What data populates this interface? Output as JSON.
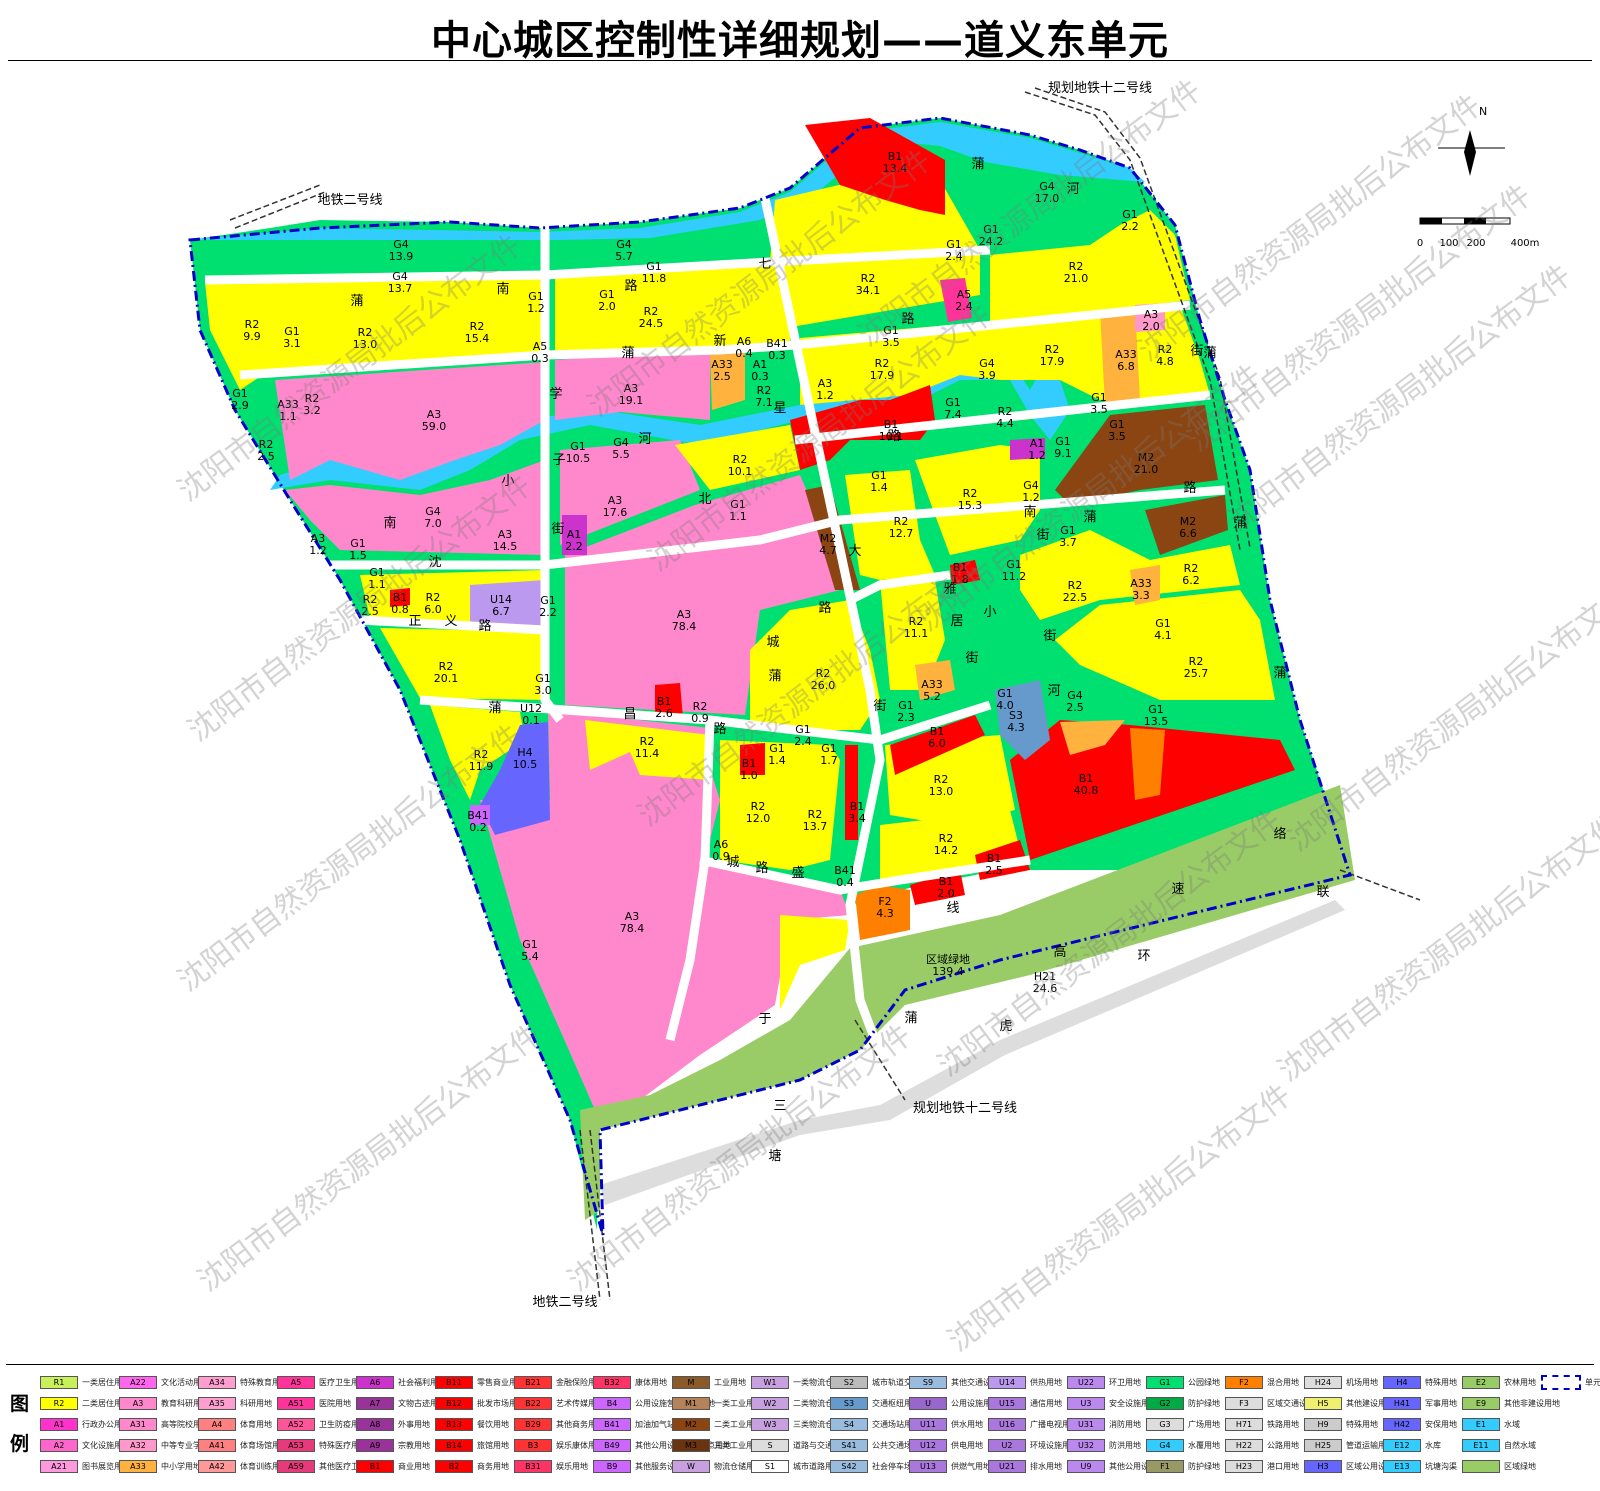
{
  "title": "中心城区控制性详细规划——道义东单元",
  "map": {
    "subway_labels": [
      {
        "id": "subway-12-top",
        "text": "规划地铁十二号线"
      },
      {
        "id": "subway-2-top",
        "text": "地铁二号线"
      },
      {
        "id": "subway-12-bottom",
        "text": "规划地铁十二号线"
      },
      {
        "id": "subway-2-bottom",
        "text": "地铁二号线"
      }
    ],
    "north_label": "N",
    "scale_ticks": [
      "0",
      "100",
      "200",
      "400m"
    ],
    "road_chars": [
      {
        "id": "r1",
        "text": "蒲"
      },
      {
        "id": "r2",
        "text": "河"
      },
      {
        "id": "r3",
        "text": "七"
      },
      {
        "id": "r4",
        "text": "南"
      },
      {
        "id": "r5",
        "text": "路"
      },
      {
        "id": "r6",
        "text": "蒲"
      },
      {
        "id": "r7",
        "text": "新"
      },
      {
        "id": "r8",
        "text": "蒲"
      },
      {
        "id": "r9",
        "text": "路"
      },
      {
        "id": "r10",
        "text": "星"
      },
      {
        "id": "r11",
        "text": "路"
      },
      {
        "id": "r12",
        "text": "学"
      },
      {
        "id": "r13",
        "text": "子"
      },
      {
        "id": "r14",
        "text": "河"
      },
      {
        "id": "r15",
        "text": "小"
      },
      {
        "id": "r16",
        "text": "南"
      },
      {
        "id": "r17",
        "text": "北"
      },
      {
        "id": "r18",
        "text": "街"
      },
      {
        "id": "r19",
        "text": "大"
      },
      {
        "id": "r20",
        "text": "沈"
      },
      {
        "id": "r21",
        "text": "正"
      },
      {
        "id": "r22",
        "text": "义"
      },
      {
        "id": "r23",
        "text": "路"
      },
      {
        "id": "r24",
        "text": "路"
      },
      {
        "id": "r25",
        "text": "城"
      },
      {
        "id": "r26",
        "text": "蒲"
      },
      {
        "id": "r27",
        "text": "昌"
      },
      {
        "id": "r28",
        "text": "路"
      },
      {
        "id": "r29",
        "text": "蒲"
      },
      {
        "id": "r30",
        "text": "街"
      },
      {
        "id": "r31",
        "text": "南"
      },
      {
        "id": "r32",
        "text": "蒲"
      },
      {
        "id": "r33",
        "text": "路"
      },
      {
        "id": "r34",
        "text": "蒲"
      },
      {
        "id": "r35",
        "text": "雅"
      },
      {
        "id": "r36",
        "text": "居"
      },
      {
        "id": "r37",
        "text": "街"
      },
      {
        "id": "r38",
        "text": "小"
      },
      {
        "id": "r39",
        "text": "街"
      },
      {
        "id": "r40",
        "text": "河"
      },
      {
        "id": "r41",
        "text": "蒲"
      },
      {
        "id": "r42",
        "text": "城"
      },
      {
        "id": "r43",
        "text": "路"
      },
      {
        "id": "r44",
        "text": "盛"
      },
      {
        "id": "r45",
        "text": "线"
      },
      {
        "id": "r46",
        "text": "络"
      },
      {
        "id": "r47",
        "text": "速"
      },
      {
        "id": "r48",
        "text": "联"
      },
      {
        "id": "r49",
        "text": "高"
      },
      {
        "id": "r50",
        "text": "环"
      },
      {
        "id": "r51",
        "text": "虎"
      },
      {
        "id": "r52",
        "text": "蒲"
      },
      {
        "id": "r53",
        "text": "于"
      },
      {
        "id": "r54",
        "text": "三"
      },
      {
        "id": "r55",
        "text": "塘"
      },
      {
        "id": "r56",
        "text": "街"
      },
      {
        "id": "r57",
        "text": "蒲"
      },
      {
        "id": "r58",
        "text": "街"
      }
    ],
    "parcels": [
      {
        "code": "B1",
        "area": "13.4"
      },
      {
        "code": "G4",
        "area": "17.0"
      },
      {
        "code": "G1",
        "area": "24.2"
      },
      {
        "code": "G1",
        "area": "2.2"
      },
      {
        "code": "G1",
        "area": "2.4"
      },
      {
        "code": "R2",
        "area": "21.0"
      },
      {
        "code": "R2",
        "area": "34.1"
      },
      {
        "code": "A5",
        "area": "2.4"
      },
      {
        "code": "G4",
        "area": "13.9"
      },
      {
        "code": "G4",
        "area": "5.7"
      },
      {
        "code": "G1",
        "area": "11.8"
      },
      {
        "code": "G4",
        "area": "13.7"
      },
      {
        "code": "G1",
        "area": "1.2"
      },
      {
        "code": "G1",
        "area": "2.0"
      },
      {
        "code": "R2",
        "area": "24.5"
      },
      {
        "code": "R2",
        "area": "9.9"
      },
      {
        "code": "G1",
        "area": "3.1"
      },
      {
        "code": "R2",
        "area": "13.0"
      },
      {
        "code": "R2",
        "area": "15.4"
      },
      {
        "code": "A5",
        "area": "0.3"
      },
      {
        "code": "A6",
        "area": "0.4"
      },
      {
        "code": "B41",
        "area": "0.3"
      },
      {
        "code": "A1",
        "area": "0.3"
      },
      {
        "code": "A33",
        "area": "2.5"
      },
      {
        "code": "R2",
        "area": "7.1"
      },
      {
        "code": "G1",
        "area": "3.5"
      },
      {
        "code": "R2",
        "area": "17.9"
      },
      {
        "code": "A3",
        "area": "2.0"
      },
      {
        "code": "A33",
        "area": "6.8"
      },
      {
        "code": "R2",
        "area": "4.8"
      },
      {
        "code": "R2",
        "area": "17.9"
      },
      {
        "code": "G4",
        "area": "3.9"
      },
      {
        "code": "A3",
        "area": "1.2"
      },
      {
        "code": "B1",
        "area": "10.1"
      },
      {
        "code": "G1",
        "area": "7.4"
      },
      {
        "code": "R2",
        "area": "4.4"
      },
      {
        "code": "G1",
        "area": "3.5"
      },
      {
        "code": "G1",
        "area": "3.5"
      },
      {
        "code": "A3",
        "area": "19.1"
      },
      {
        "code": "G1",
        "area": "2.9"
      },
      {
        "code": "A33",
        "area": "1.1"
      },
      {
        "code": "R2",
        "area": "3.2"
      },
      {
        "code": "A3",
        "area": "59.0"
      },
      {
        "code": "R2",
        "area": "2.5"
      },
      {
        "code": "G1",
        "area": "10.5"
      },
      {
        "code": "G4",
        "area": "5.5"
      },
      {
        "code": "R2",
        "area": "10.1"
      },
      {
        "code": "A1",
        "area": "1.2"
      },
      {
        "code": "G1",
        "area": "9.1"
      },
      {
        "code": "M2",
        "area": "21.0"
      },
      {
        "code": "G1",
        "area": "1.4"
      },
      {
        "code": "R2",
        "area": "15.3"
      },
      {
        "code": "A3",
        "area": "17.6"
      },
      {
        "code": "G1",
        "area": "1.1"
      },
      {
        "code": "G4",
        "area": "1.2"
      },
      {
        "code": "M2",
        "area": "6.6"
      },
      {
        "code": "G4",
        "area": "7.0"
      },
      {
        "code": "A3",
        "area": "14.5"
      },
      {
        "code": "A1",
        "area": "2.2"
      },
      {
        "code": "M2",
        "area": "4.7"
      },
      {
        "code": "R2",
        "area": "12.7"
      },
      {
        "code": "G1",
        "area": "3.7"
      },
      {
        "code": "A3",
        "area": "1.2"
      },
      {
        "code": "G1",
        "area": "1.5"
      },
      {
        "code": "G1",
        "area": "11.2"
      },
      {
        "code": "B1",
        "area": "1.8"
      },
      {
        "code": "R2",
        "area": "22.5"
      },
      {
        "code": "A33",
        "area": "3.3"
      },
      {
        "code": "R2",
        "area": "6.2"
      },
      {
        "code": "G1",
        "area": "1.1"
      },
      {
        "code": "R2",
        "area": "2.5"
      },
      {
        "code": "B1",
        "area": "0.8"
      },
      {
        "code": "R2",
        "area": "6.0"
      },
      {
        "code": "U14",
        "area": "6.7"
      },
      {
        "code": "G1",
        "area": "2.2"
      },
      {
        "code": "A3",
        "area": "78.4"
      },
      {
        "code": "R2",
        "area": "11.1"
      },
      {
        "code": "G1",
        "area": "4.1"
      },
      {
        "code": "R2",
        "area": "25.7"
      },
      {
        "code": "R2",
        "area": "20.1"
      },
      {
        "code": "G1",
        "area": "3.0"
      },
      {
        "code": "R2",
        "area": "26.0"
      },
      {
        "code": "A33",
        "area": "5.2"
      },
      {
        "code": "G1",
        "area": "4.0"
      },
      {
        "code": "G4",
        "area": "2.5"
      },
      {
        "code": "S3",
        "area": "4.3"
      },
      {
        "code": "G1",
        "area": "13.5"
      },
      {
        "code": "B1",
        "area": "2.6"
      },
      {
        "code": "R2",
        "area": "0.9"
      },
      {
        "code": "U12",
        "area": "0.1"
      },
      {
        "code": "G1",
        "area": "2.3"
      },
      {
        "code": "G1",
        "area": "2.4"
      },
      {
        "code": "B1",
        "area": "6.0"
      },
      {
        "code": "R2",
        "area": "11.4"
      },
      {
        "code": "R2",
        "area": "11.9"
      },
      {
        "code": "H4",
        "area": "10.5"
      },
      {
        "code": "G1",
        "area": "1.4"
      },
      {
        "code": "G1",
        "area": "1.7"
      },
      {
        "code": "B1",
        "area": "1.0"
      },
      {
        "code": "R2",
        "area": "13.0"
      },
      {
        "code": "B1",
        "area": "40.8"
      },
      {
        "code": "B41",
        "area": "0.2"
      },
      {
        "code": "R2",
        "area": "12.0"
      },
      {
        "code": "R2",
        "area": "13.7"
      },
      {
        "code": "B1",
        "area": "3.4"
      },
      {
        "code": "R2",
        "area": "14.2"
      },
      {
        "code": "A6",
        "area": "0.9"
      },
      {
        "code": "B41",
        "area": "0.4"
      },
      {
        "code": "B1",
        "area": "2.5"
      },
      {
        "code": "B1",
        "area": "2.0"
      },
      {
        "code": "F2",
        "area": "4.3"
      },
      {
        "code": "A3",
        "area": "78.4"
      },
      {
        "code": "G1",
        "area": "5.4"
      },
      {
        "code": "区域绿地",
        "area": "139.4"
      },
      {
        "code": "H21",
        "area": "24.6"
      }
    ],
    "watermark": "沈阳市自然资源局批后公布文件"
  },
  "legend": {
    "side_label_top": "图",
    "side_label_bottom": "例",
    "items": [
      {
        "code": "R1",
        "text": "一类居住用地",
        "color": "#c8f05a"
      },
      {
        "code": "R2",
        "text": "二类居住用地",
        "color": "#ffff00"
      },
      {
        "code": "A1",
        "text": "行政办公用地",
        "color": "#ff33cc"
      },
      {
        "code": "A2",
        "text": "文化设施用地",
        "color": "#ff66cc"
      },
      {
        "code": "A21",
        "text": "图书展览用地",
        "color": "#ff99dd"
      },
      {
        "code": "A22",
        "text": "文化活动用地",
        "color": "#ff66ee"
      },
      {
        "code": "A3",
        "text": "教育科研用地",
        "color": "#ff88cc"
      },
      {
        "code": "A31",
        "text": "高等院校用地",
        "color": "#ff88cc"
      },
      {
        "code": "A32",
        "text": "中等专业学校用地",
        "color": "#ff99cc"
      },
      {
        "code": "A33",
        "text": "中小学用地",
        "color": "#ffb23d"
      },
      {
        "code": "A34",
        "text": "特殊教育用地",
        "color": "#ff9fcf"
      },
      {
        "code": "A35",
        "text": "科研用地",
        "color": "#ff9fcf"
      },
      {
        "code": "A4",
        "text": "体育用地",
        "color": "#ff8080"
      },
      {
        "code": "A41",
        "text": "体育场馆用地",
        "color": "#ff8080"
      },
      {
        "code": "A42",
        "text": "体育训练用地",
        "color": "#ff9999"
      },
      {
        "code": "A5",
        "text": "医疗卫生用地",
        "color": "#ff3399"
      },
      {
        "code": "A51",
        "text": "医院用地",
        "color": "#ff3399"
      },
      {
        "code": "A52",
        "text": "卫生防疫用地",
        "color": "#ff5599"
      },
      {
        "code": "A53",
        "text": "特殊医疗用地",
        "color": "#e83a7a"
      },
      {
        "code": "A59",
        "text": "其他医疗卫生用地",
        "color": "#e83a7a"
      },
      {
        "code": "A6",
        "text": "社会福利用地",
        "color": "#cc33cc"
      },
      {
        "code": "A7",
        "text": "文物古迹用地",
        "color": "#993399"
      },
      {
        "code": "A8",
        "text": "外事用地",
        "color": "#993399"
      },
      {
        "code": "A9",
        "text": "宗教用地",
        "color": "#993399"
      },
      {
        "code": "B1",
        "text": "商业用地",
        "color": "#ff0000"
      },
      {
        "code": "B11",
        "text": "零售商业用地",
        "color": "#ff0000"
      },
      {
        "code": "B12",
        "text": "批发市场用地",
        "color": "#ff0000"
      },
      {
        "code": "B13",
        "text": "餐饮用地",
        "color": "#ff0000"
      },
      {
        "code": "B14",
        "text": "旅馆用地",
        "color": "#ff0000"
      },
      {
        "code": "B2",
        "text": "商务用地",
        "color": "#ff0000"
      },
      {
        "code": "B21",
        "text": "金融保险用地",
        "color": "#ff3333"
      },
      {
        "code": "B22",
        "text": "艺术传媒用地",
        "color": "#ff3333"
      },
      {
        "code": "B29",
        "text": "其他商务用地",
        "color": "#ff3333"
      },
      {
        "code": "B3",
        "text": "娱乐康体用地",
        "color": "#ff3333"
      },
      {
        "code": "B31",
        "text": "娱乐用地",
        "color": "#ff3366"
      },
      {
        "code": "B32",
        "text": "康体用地",
        "color": "#ff3366"
      },
      {
        "code": "B4",
        "text": "公用设施营业网点用地",
        "color": "#cc66ff"
      },
      {
        "code": "B41",
        "text": "加油加气站用地",
        "color": "#cc66ff"
      },
      {
        "code": "B49",
        "text": "其他公用设施营业网点用地",
        "color": "#cc66ff"
      },
      {
        "code": "B9",
        "text": "其他服务设施用地",
        "color": "#cc66ff"
      },
      {
        "code": "M",
        "text": "工业用地",
        "color": "#8b5a2b"
      },
      {
        "code": "M1",
        "text": "一类工业用地",
        "color": "#b5835a"
      },
      {
        "code": "M2",
        "text": "二类工业用地",
        "color": "#8b4513"
      },
      {
        "code": "M3",
        "text": "三类工业用地",
        "color": "#6b3410"
      },
      {
        "code": "W",
        "text": "物流仓储用地",
        "color": "#c8a0e0"
      },
      {
        "code": "W1",
        "text": "一类物流仓储用地",
        "color": "#c8a0e0"
      },
      {
        "code": "W2",
        "text": "二类物流仓储用地",
        "color": "#c8a0e0"
      },
      {
        "code": "W3",
        "text": "三类物流仓储用地",
        "color": "#c8a0e0"
      },
      {
        "code": "S",
        "text": "道路与交通设施用地",
        "color": "#dddddd"
      },
      {
        "code": "S1",
        "text": "城市道路用地",
        "color": "#ffffff"
      },
      {
        "code": "S2",
        "text": "城市轨道交通用地",
        "color": "#bbbbbb"
      },
      {
        "code": "S3",
        "text": "交通枢纽用地",
        "color": "#6699cc"
      },
      {
        "code": "S4",
        "text": "交通场站用地",
        "color": "#99bbdd"
      },
      {
        "code": "S41",
        "text": "公共交通场站用地",
        "color": "#99bbdd"
      },
      {
        "code": "S42",
        "text": "社会停车场用地",
        "color": "#99bbdd"
      },
      {
        "code": "S9",
        "text": "其他交通设施用地",
        "color": "#99bbdd"
      },
      {
        "code": "U",
        "text": "公用设施用地",
        "color": "#9966cc"
      },
      {
        "code": "U11",
        "text": "供水用地",
        "color": "#aa77dd"
      },
      {
        "code": "U12",
        "text": "供电用地",
        "color": "#aa77dd"
      },
      {
        "code": "U13",
        "text": "供燃气用地",
        "color": "#aa77dd"
      },
      {
        "code": "U14",
        "text": "供热用地",
        "color": "#bb99ee"
      },
      {
        "code": "U15",
        "text": "通信用地",
        "color": "#aa77dd"
      },
      {
        "code": "U16",
        "text": "广播电视用地",
        "color": "#aa77dd"
      },
      {
        "code": "U2",
        "text": "环境设施用地",
        "color": "#aa77dd"
      },
      {
        "code": "U21",
        "text": "排水用地",
        "color": "#aa77dd"
      },
      {
        "code": "U22",
        "text": "环卫用地",
        "color": "#bb88ee"
      },
      {
        "code": "U3",
        "text": "安全设施用地",
        "color": "#bb88ee"
      },
      {
        "code": "U31",
        "text": "消防用地",
        "color": "#bb88ee"
      },
      {
        "code": "U32",
        "text": "防洪用地",
        "color": "#bb88ee"
      },
      {
        "code": "U9",
        "text": "其他公用设施用地",
        "color": "#bb88ee"
      },
      {
        "code": "G1",
        "text": "公园绿地",
        "color": "#00e070"
      },
      {
        "code": "G2",
        "text": "防护绿地",
        "color": "#00aa44"
      },
      {
        "code": "G3",
        "text": "广场用地",
        "color": "#dddddd"
      },
      {
        "code": "G4",
        "text": "水覆用地",
        "color": "#33ccff"
      },
      {
        "code": "F1",
        "text": "防护绿地",
        "color": "#999966"
      },
      {
        "code": "F2",
        "text": "混合用地",
        "color": "#ff8000"
      },
      {
        "code": "F3",
        "text": "区域交通设施用地",
        "color": "#dddddd"
      },
      {
        "code": "H71",
        "text": "铁路用地",
        "color": "#dddddd"
      },
      {
        "code": "H22",
        "text": "公路用地",
        "color": "#dddddd"
      },
      {
        "code": "H23",
        "text": "港口用地",
        "color": "#dddddd"
      },
      {
        "code": "H24",
        "text": "机场用地",
        "color": "#dddddd"
      },
      {
        "code": "H5",
        "text": "其他建设用地",
        "color": "#f0f070"
      },
      {
        "code": "H9",
        "text": "特殊用地",
        "color": "#cccccc"
      },
      {
        "code": "H25",
        "text": "管道运输用地",
        "color": "#cccccc"
      },
      {
        "code": "H3",
        "text": "区域公用设施用地",
        "color": "#6666ff"
      },
      {
        "code": "H4",
        "text": "特殊用地",
        "color": "#6666ff"
      },
      {
        "code": "H41",
        "text": "军事用地",
        "color": "#6666ff"
      },
      {
        "code": "H42",
        "text": "安保用地",
        "color": "#6666ff"
      },
      {
        "code": "E12",
        "text": "水库",
        "color": "#33ccff"
      },
      {
        "code": "E13",
        "text": "坑塘沟渠",
        "color": "#33ccff"
      },
      {
        "code": "E2",
        "text": "农林用地",
        "color": "#99cc66"
      },
      {
        "code": "E9",
        "text": "其他非建设用地",
        "color": "#99cc66"
      },
      {
        "code": "E1",
        "text": "水域",
        "color": "#33ccff"
      },
      {
        "code": "E11",
        "text": "自然水域",
        "color": "#33ccff"
      },
      {
        "code": "",
        "text": "区域绿地",
        "color": "#99cc66"
      },
      {
        "code": "",
        "text": "单元界线",
        "color": "#ffffff"
      }
    ]
  }
}
